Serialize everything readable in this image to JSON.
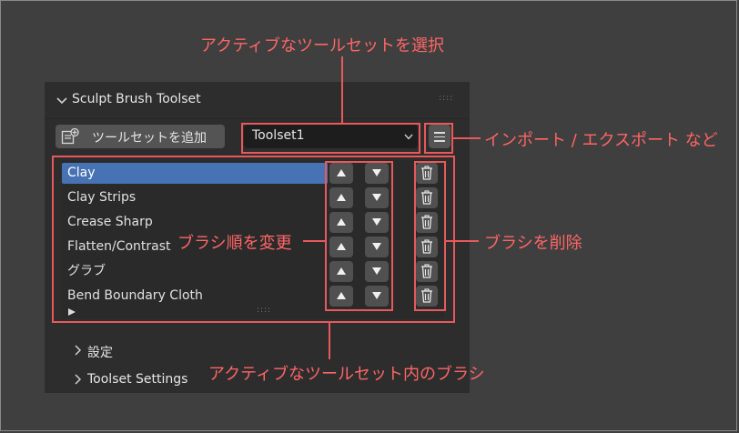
{
  "panel": {
    "title": "Sculpt Brush Toolset",
    "add_button_label": "ツールセットを追加",
    "toolset_select_value": "Toolset1",
    "brushes": [
      "Clay",
      "Clay Strips",
      "Crease Sharp",
      "Flatten/Contrast",
      "グラブ",
      "Bend Boundary Cloth"
    ],
    "active_brush_index": 0,
    "subpanels": [
      "設定",
      "Toolset Settings"
    ]
  },
  "annotations": {
    "select_toolset": "アクティブなツールセットを選択",
    "import_export": "インポート / エクスポート など",
    "reorder": "ブラシ順を変更",
    "delete": "ブラシを削除",
    "brushes_in_toolset": "アクティブなツールセット内のブラシ"
  },
  "colors": {
    "background": "#3f3f3f",
    "panel": "#2d2d2d",
    "active_row": "#4772b3",
    "annotation": "#ff6565",
    "button": "#505050"
  },
  "icons": [
    "chevron-down-icon",
    "add-toolset-icon",
    "menu-icon",
    "arrow-up-icon",
    "arrow-down-icon",
    "trash-icon",
    "play-triangle-icon",
    "chevron-right-icon"
  ]
}
